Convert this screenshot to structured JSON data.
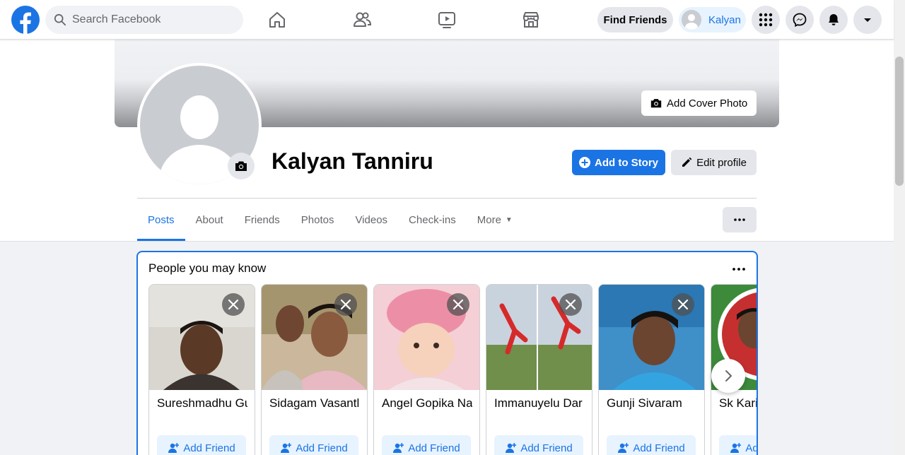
{
  "nav": {
    "search_placeholder": "Search Facebook",
    "find_friends_label": "Find Friends",
    "user_chip_name": "Kalyan"
  },
  "profile": {
    "name": "Kalyan Tanniru",
    "add_cover_label": "Add Cover Photo",
    "add_story_label": "Add to Story",
    "edit_profile_label": "Edit profile"
  },
  "tabs": [
    {
      "label": "Posts",
      "active": true
    },
    {
      "label": "About"
    },
    {
      "label": "Friends"
    },
    {
      "label": "Photos"
    },
    {
      "label": "Videos"
    },
    {
      "label": "Check-ins"
    },
    {
      "label": "More"
    }
  ],
  "pymk": {
    "title": "People you may know",
    "add_friend_label": "Add Friend",
    "people": [
      {
        "name": "Sureshmadhu Gu"
      },
      {
        "name": "Sidagam Vasantl"
      },
      {
        "name": "Angel Gopika Na"
      },
      {
        "name": "Immanuyelu Dar"
      },
      {
        "name": "Gunji Sivaram"
      },
      {
        "name": "Sk Kari"
      }
    ]
  },
  "colors": {
    "brand": "#1b74e4",
    "chip_bg": "#e7f3ff",
    "button_bg": "#e4e6eb"
  }
}
